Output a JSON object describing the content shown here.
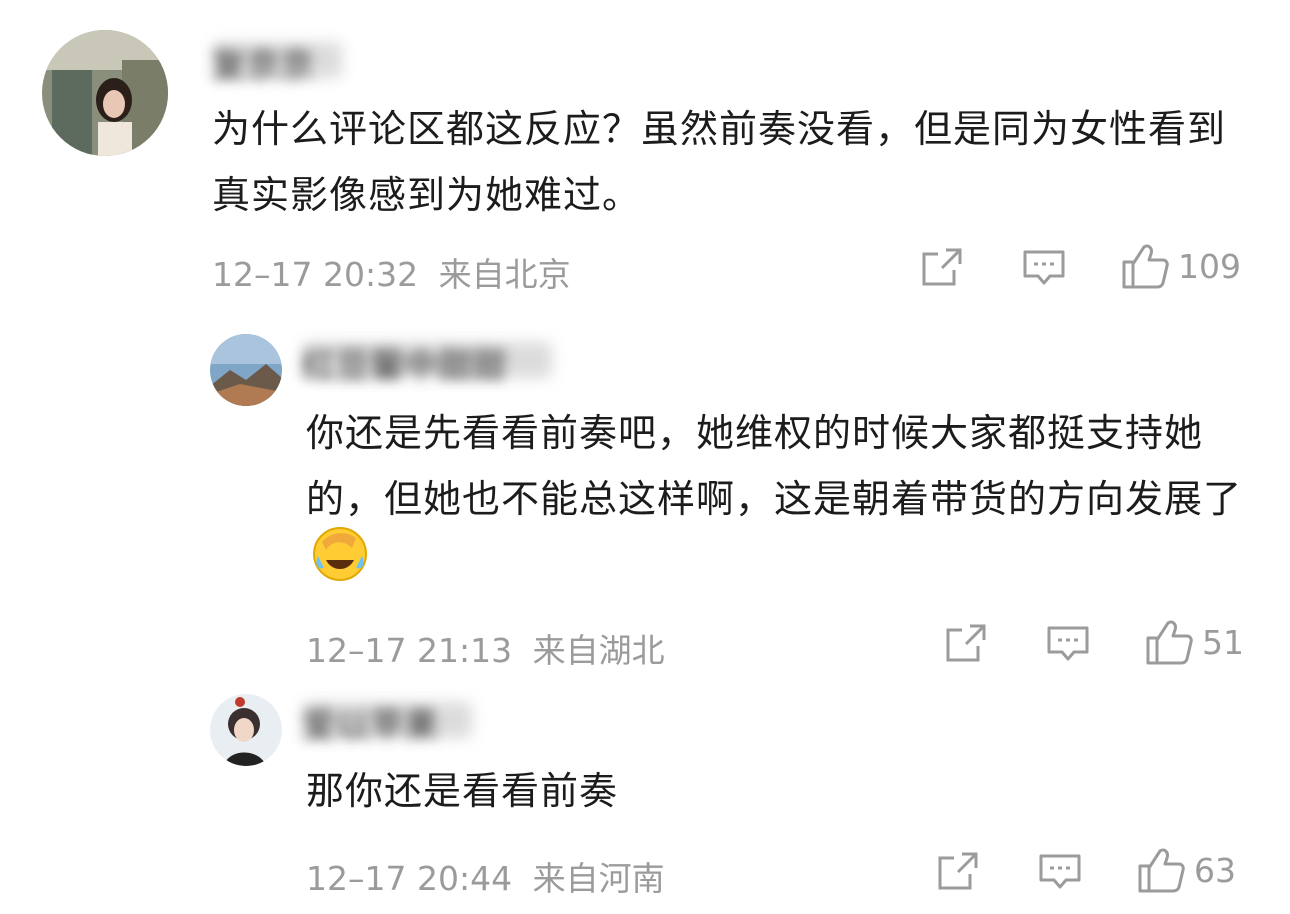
{
  "comments": [
    {
      "author": "复京京",
      "text": "为什么评论区都这反应？虽然前奏没看，但是同为女性看到真实影像感到为她难过。",
      "time": "12–17 20:32",
      "location": "来自北京",
      "likes": "109",
      "level": "top"
    },
    {
      "author": "红豆馨中甜甜",
      "text": "你还是先看看前奏吧，她维权的时候大家都挺支持她的，但她也不能总这样啊，这是朝着带货的方向发展了",
      "emoji": "facepalm-laugh-emoji",
      "time": "12–17 21:13",
      "location": "来自湖北",
      "likes": "51",
      "level": "reply"
    },
    {
      "author": "爱以苹果",
      "text": "那你还是看看前奏",
      "time": "12–17 20:44",
      "location": "来自河南",
      "likes": "63",
      "level": "reply"
    }
  ],
  "icons": {
    "share": "share-icon",
    "comment": "comment-icon",
    "like": "thumbs-up-icon"
  },
  "colors": {
    "meta": "#9b9b9b",
    "text": "#1c1c1c"
  }
}
